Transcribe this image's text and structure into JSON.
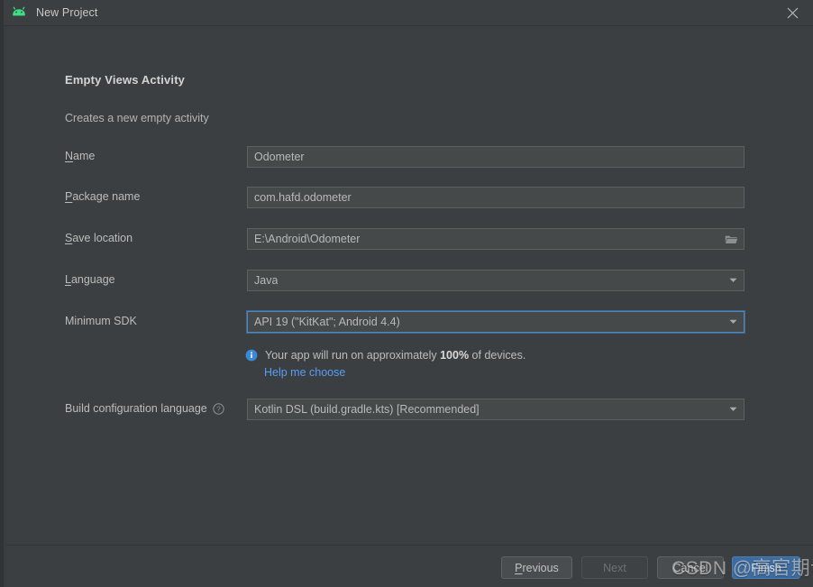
{
  "window": {
    "title": "New Project",
    "app_icon": "android-robot-icon",
    "close_icon": "close-icon"
  },
  "form": {
    "heading": "Empty Views Activity",
    "subheading": "Creates a new empty activity",
    "fields": [
      {
        "id": "name",
        "label_pre": "",
        "label_mnemonic": "N",
        "label_post": "ame",
        "value": "Odometer",
        "type": "text"
      },
      {
        "id": "package-name",
        "label_pre": "",
        "label_mnemonic": "P",
        "label_post": "ackage name",
        "value": "com.hafd.odometer",
        "type": "text"
      },
      {
        "id": "save-location",
        "label_pre": "",
        "label_mnemonic": "S",
        "label_post": "ave location",
        "value": "E:\\Android\\Odometer",
        "type": "text-browse",
        "browse_icon": "folder-icon"
      },
      {
        "id": "language",
        "label_pre": "",
        "label_mnemonic": "L",
        "label_post": "anguage",
        "value": "Java",
        "type": "combo",
        "focused": false
      },
      {
        "id": "minimum-sdk",
        "label_pre": "Minimum SDK",
        "label_mnemonic": "",
        "label_post": "",
        "value": "API 19 (\"KitKat\"; Android 4.4)",
        "type": "combo",
        "focused": true
      },
      {
        "id": "build-configuration-language",
        "label_pre": "Build configuration language",
        "label_mnemonic": "",
        "label_post": "",
        "value": "Kotlin DSL (build.gradle.kts) [Recommended]",
        "type": "combo",
        "focused": false,
        "help_icon": "question-mark-icon"
      }
    ],
    "info": {
      "icon": "info-icon",
      "text_before": "Your app will run on approximately ",
      "percent": "100%",
      "text_after": " of devices.",
      "link": "Help me choose"
    }
  },
  "footer": {
    "buttons": [
      {
        "id": "previous",
        "label_pre": "",
        "label_mnemonic": "P",
        "label_post": "revious",
        "state": "enabled"
      },
      {
        "id": "next",
        "label_pre": "Next",
        "label_mnemonic": "",
        "label_post": "",
        "state": "disabled"
      },
      {
        "id": "cancel",
        "label_pre": "Cancel",
        "label_mnemonic": "",
        "label_post": "",
        "state": "enabled"
      },
      {
        "id": "finish",
        "label_pre": "Finish",
        "label_mnemonic": "",
        "label_post": "",
        "state": "primary"
      }
    ]
  },
  "watermark": {
    "text": "CSDN @高官期许"
  },
  "colors": {
    "background": "#3c3f41",
    "field_background": "#45494a",
    "field_border": "#5e6060",
    "accent_blue": "#4a88c7",
    "link_blue": "#589df6",
    "primary_button": "#3c6ba0",
    "android_green": "#3ddc84",
    "text": "#bbbbbb"
  }
}
